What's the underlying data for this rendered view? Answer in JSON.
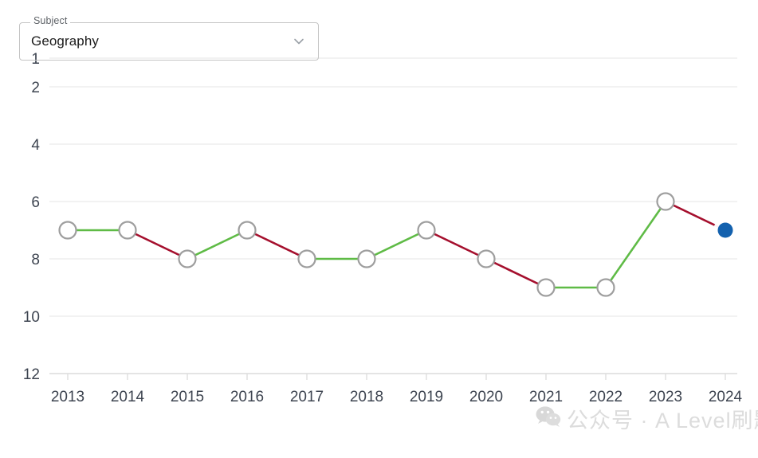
{
  "select": {
    "label": "Subject",
    "value": "Geography",
    "icon": "chevron-down-icon"
  },
  "watermark": {
    "text": "公众号 · A Level刷题",
    "icon": "wechat-icon"
  },
  "colors": {
    "improve": "#5FBB46",
    "decline": "#A50F2D",
    "current": "#1361AE",
    "marker_stroke": "#9E9E9E",
    "marker_fill": "#FFFFFF",
    "grid": "#EDEDED",
    "tick_text": "#3D4450"
  },
  "chart_data": {
    "type": "line",
    "title": "",
    "xlabel": "",
    "ylabel": "",
    "x": [
      2013,
      2014,
      2015,
      2016,
      2017,
      2018,
      2019,
      2020,
      2021,
      2022,
      2023,
      2024
    ],
    "xtick_labels": [
      "2013",
      "2014",
      "2015",
      "2016",
      "2017",
      "2018",
      "2019",
      "2020",
      "2021",
      "2022",
      "2023",
      "2024"
    ],
    "values": [
      7,
      7,
      8,
      7,
      8,
      8,
      7,
      8,
      9,
      9,
      6,
      7
    ],
    "ytick_labels": [
      "1",
      "2",
      "4",
      "6",
      "8",
      "10",
      "12"
    ],
    "ytick_values": [
      1,
      2,
      4,
      6,
      8,
      10,
      12
    ],
    "ylim": [
      1,
      12
    ],
    "y_inverted": true,
    "grid": true,
    "legend": "none",
    "segment_colors": [
      "improve",
      "decline",
      "improve",
      "decline",
      "improve",
      "improve",
      "decline",
      "decline",
      "improve",
      "improve",
      "decline"
    ],
    "highlight_index": 11,
    "highlight_value": 7,
    "marker_style": "open-circle"
  }
}
